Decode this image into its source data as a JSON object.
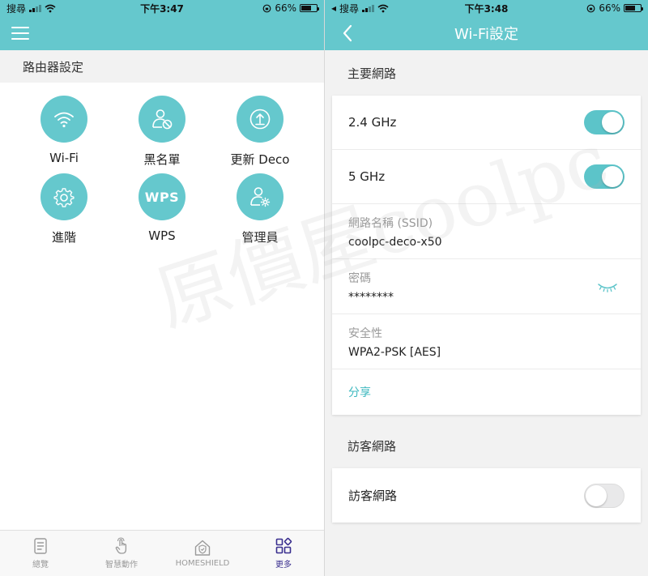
{
  "left_screen": {
    "status": {
      "carrier": "搜尋",
      "time": "下午3:47",
      "battery": "66%"
    },
    "section_title": "路由器設定",
    "tiles": [
      {
        "label": "Wi-Fi",
        "icon": "wifi-icon"
      },
      {
        "label": "黑名單",
        "icon": "blocked-user-icon"
      },
      {
        "label": "更新 Deco",
        "icon": "firmware-update-icon"
      },
      {
        "label": "進階",
        "icon": "gear-icon"
      },
      {
        "label": "WPS",
        "icon": "wps-icon",
        "icon_text": "WPS"
      },
      {
        "label": "管理員",
        "icon": "admin-user-icon"
      }
    ],
    "tabs": [
      {
        "label": "總覽",
        "icon": "overview-icon",
        "active": false
      },
      {
        "label": "智慧動作",
        "icon": "smart-action-icon",
        "active": false
      },
      {
        "label": "HOMESHIELD",
        "icon": "homeshield-icon",
        "active": false
      },
      {
        "label": "更多",
        "icon": "more-icon",
        "active": true
      }
    ]
  },
  "right_screen": {
    "status": {
      "carrier": "搜尋",
      "time": "下午3:48",
      "battery": "66%"
    },
    "title": "Wi-Fi設定",
    "main_network": {
      "title": "主要網路",
      "band_24": {
        "label": "2.4 GHz",
        "enabled": true
      },
      "band_5": {
        "label": "5 GHz",
        "enabled": true
      },
      "ssid": {
        "label": "網路名稱 (SSID)",
        "value": "coolpc-deco-x50"
      },
      "password": {
        "label": "密碼",
        "value": "********"
      },
      "security": {
        "label": "安全性",
        "value": "WPA2-PSK [AES]"
      },
      "share_label": "分享"
    },
    "guest_network": {
      "title": "訪客網路",
      "toggle_label": "訪客網路",
      "enabled": false
    }
  },
  "watermark": "原價屋coolpc",
  "colors": {
    "accent": "#65c8cd",
    "active_tab": "#3a2f8f",
    "link": "#3db8bf"
  }
}
